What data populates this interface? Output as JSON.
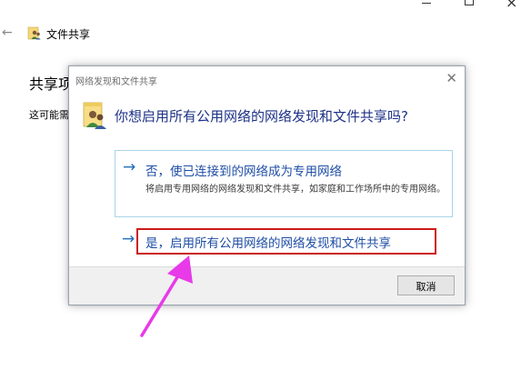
{
  "background_window": {
    "title": "文件共享",
    "heading": "共享项",
    "description": "这可能需"
  },
  "dialog": {
    "title": "网络发现和文件共享",
    "question": "你想启用所有公用网络的网络发现和文件共享吗?",
    "option_no": {
      "label": "否，使已连接到的网络成为专用网络",
      "detail": "将启用专用网络的网络发现和文件共享，如家庭和工作场所中的专用网络。"
    },
    "option_yes": {
      "label": "是，启用所有公用网络的网络发现和文件共享"
    },
    "cancel_label": "取消"
  },
  "colors": {
    "highlight_border": "#cc1a1a",
    "pointer_arrow": "#e83ae8",
    "option_text": "#1f4ea5",
    "question_text": "#1e3287"
  },
  "icons": [
    "back-arrow-icon",
    "users-folder-icon",
    "close-icon",
    "right-arrow-icon",
    "window-minimize-icon",
    "window-maximize-icon",
    "window-close-icon"
  ]
}
